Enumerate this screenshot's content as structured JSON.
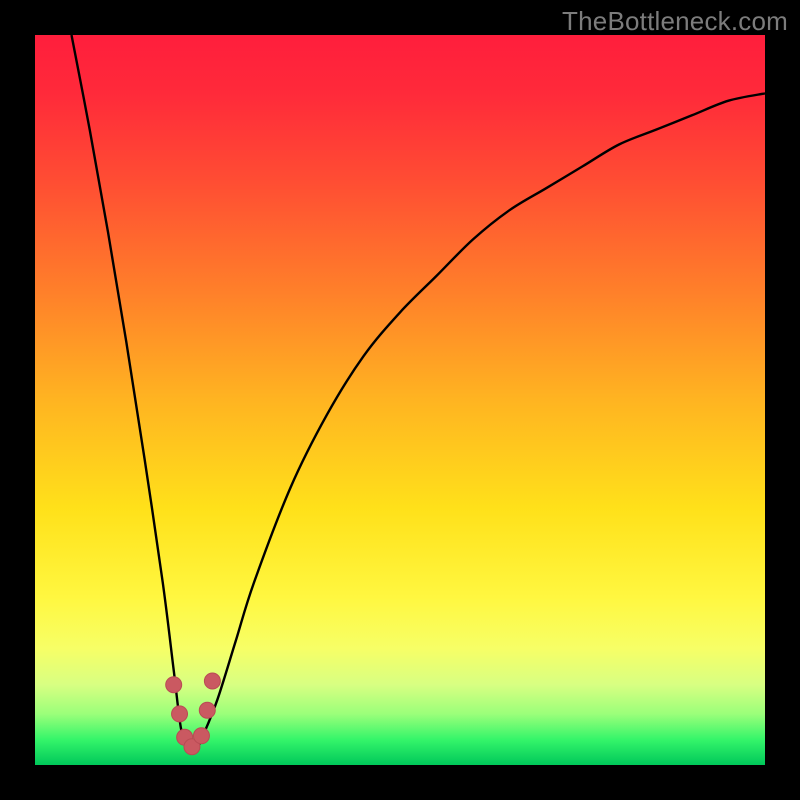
{
  "watermark": "TheBottleneck.com",
  "colors": {
    "frame": "#000000",
    "dot_fill": "#ca5961",
    "dot_stroke": "#b94b54",
    "curve": "#000000",
    "gradient_stops": [
      {
        "offset": 0.0,
        "color": "#ff1e3c"
      },
      {
        "offset": 0.08,
        "color": "#ff2a3a"
      },
      {
        "offset": 0.2,
        "color": "#ff4d33"
      },
      {
        "offset": 0.35,
        "color": "#ff7f2a"
      },
      {
        "offset": 0.5,
        "color": "#ffb421"
      },
      {
        "offset": 0.65,
        "color": "#ffe11a"
      },
      {
        "offset": 0.77,
        "color": "#fff740"
      },
      {
        "offset": 0.84,
        "color": "#f7ff66"
      },
      {
        "offset": 0.89,
        "color": "#d8ff82"
      },
      {
        "offset": 0.93,
        "color": "#9bff7a"
      },
      {
        "offset": 0.965,
        "color": "#35f56a"
      },
      {
        "offset": 1.0,
        "color": "#00c85a"
      }
    ]
  },
  "chart_data": {
    "type": "line",
    "title": "",
    "xlabel": "",
    "ylabel": "",
    "xlim": [
      0,
      100
    ],
    "ylim": [
      0,
      100
    ],
    "series": [
      {
        "name": "bottleneck-curve",
        "x": [
          5,
          7.5,
          10,
          12.5,
          15,
          17.5,
          19,
          20,
          21,
          22,
          23,
          25,
          27.5,
          30,
          35,
          40,
          45,
          50,
          55,
          60,
          65,
          70,
          75,
          80,
          85,
          90,
          95,
          100
        ],
        "y": [
          100,
          87,
          73,
          58,
          42,
          25,
          13,
          5,
          2,
          2,
          4,
          9,
          17,
          25,
          38,
          48,
          56,
          62,
          67,
          72,
          76,
          79,
          82,
          85,
          87,
          89,
          91,
          92
        ]
      }
    ],
    "dots": {
      "name": "highlight-dots",
      "points": [
        {
          "x": 19.0,
          "y": 11.0
        },
        {
          "x": 19.8,
          "y": 7.0
        },
        {
          "x": 20.5,
          "y": 3.8
        },
        {
          "x": 21.5,
          "y": 2.5
        },
        {
          "x": 22.8,
          "y": 4.0
        },
        {
          "x": 23.6,
          "y": 7.5
        },
        {
          "x": 24.3,
          "y": 11.5
        }
      ],
      "radius_px": 8
    }
  }
}
